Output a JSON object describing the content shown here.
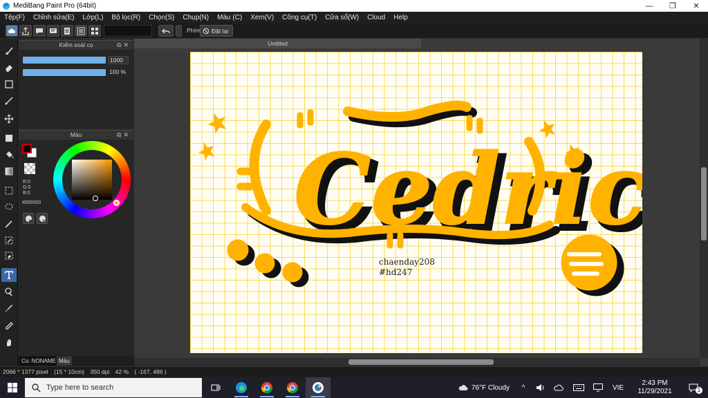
{
  "window": {
    "title": "MediBang Paint Pro (64bit)",
    "controls": {
      "minimize": "—",
      "maximize": "❐",
      "close": "✕"
    }
  },
  "menu": [
    "Tệp(F)",
    "Chỉnh sửa(E)",
    "Lớp(L)",
    "Bộ lọc(R)",
    "Chọn(S)",
    "Chụp(N)",
    "Màu (C)",
    "Xem(V)",
    "Công cụ(T)",
    "Cửa sổ(W)",
    "Cloud",
    "Help"
  ],
  "toolbar": {
    "brush_label": "Phím",
    "reset_label": "Đặt lại"
  },
  "brush_panel": {
    "title": "Kiểm soát cọ",
    "size_value": "1000",
    "opacity_value": "100 %"
  },
  "color_panel": {
    "title": "Màu",
    "r_label": "R:0",
    "g_label": "G:0",
    "b_label": "B:0",
    "hex": "#000000",
    "fg_color": "#000000",
    "bg_color": "#ffffff"
  },
  "bottom_tabs": {
    "first": "Co: NONAME",
    "second": "Màu"
  },
  "document": {
    "tab_title": "Untitled",
    "artwork_title": "Cedric",
    "credit_line_1": "chaenday208",
    "credit_line_2": "#hd247"
  },
  "status": {
    "pixels": "2066 * 1377 pixel",
    "size_cm": "(15 * 10cm)",
    "dpi": "350 dpi",
    "zoom": "42 %",
    "coords": "( -167, 486 )"
  },
  "taskbar": {
    "search_placeholder": "Type here to search",
    "weather": "76°F  Cloudy",
    "lang": "VIE",
    "time": "2:43 PM",
    "date": "11/29/2021",
    "notification_count": "1"
  },
  "colors": {
    "accent": "#ffb300",
    "shadow": "#111111",
    "grid": "#f6d640",
    "paper": "#fffdf3",
    "slider": "#6fb0e8",
    "active_tool": "#3b6aa8"
  }
}
